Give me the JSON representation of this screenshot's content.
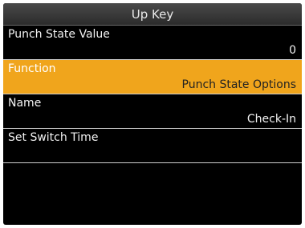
{
  "header": {
    "title": "Up Key"
  },
  "menu": {
    "items": [
      {
        "label": "Punch State Value",
        "value": "0"
      },
      {
        "label": "Function",
        "value": "Punch State Options"
      },
      {
        "label": "Name",
        "value": "Check-In"
      },
      {
        "label": "Set Switch Time",
        "value": ""
      }
    ],
    "selected_index": 1
  },
  "colors": {
    "background": "#000000",
    "selection": "#f0a51c",
    "text": "#f2f2f2"
  }
}
